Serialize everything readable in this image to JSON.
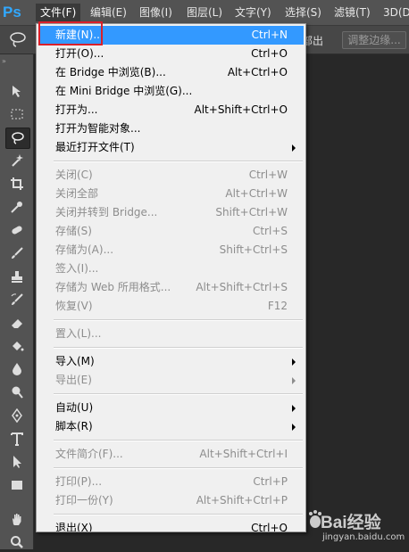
{
  "app": {
    "logo": "Ps"
  },
  "menubar": {
    "items": [
      {
        "label": "文件(F)",
        "active": true
      },
      {
        "label": "编辑(E)"
      },
      {
        "label": "图像(I)"
      },
      {
        "label": "图层(L)"
      },
      {
        "label": "文字(Y)"
      },
      {
        "label": "选择(S)"
      },
      {
        "label": "滤镜(T)"
      },
      {
        "label": "3D(D"
      }
    ]
  },
  "options_bar": {
    "partial_text": "部出",
    "refine_edge_label": "调整边缘..."
  },
  "toolbox": {
    "grip": "»",
    "tools": [
      "move-tool",
      "marquee-tool",
      "lasso-tool",
      "magic-wand-tool",
      "crop-tool",
      "eyedropper-tool",
      "healing-brush-tool",
      "brush-tool",
      "clone-stamp-tool",
      "history-brush-tool",
      "eraser-tool",
      "paint-bucket-tool",
      "blur-tool",
      "dodge-tool",
      "pen-tool",
      "type-tool",
      "path-selection-tool",
      "rectangle-tool",
      "hand-tool",
      "zoom-tool"
    ]
  },
  "file_menu": {
    "items": [
      {
        "label": "新建(N)...",
        "shortcut": "Ctrl+N",
        "highlighted": true
      },
      {
        "label": "打开(O)...",
        "shortcut": "Ctrl+O"
      },
      {
        "label": "在 Bridge 中浏览(B)...",
        "shortcut": "Alt+Ctrl+O"
      },
      {
        "label": "在 Mini Bridge 中浏览(G)...",
        "shortcut": ""
      },
      {
        "label": "打开为...",
        "shortcut": "Alt+Shift+Ctrl+O"
      },
      {
        "label": "打开为智能对象...",
        "shortcut": ""
      },
      {
        "label": "最近打开文件(T)",
        "shortcut": "",
        "submenu": true
      },
      {
        "separator": true
      },
      {
        "label": "关闭(C)",
        "shortcut": "Ctrl+W",
        "disabled": true
      },
      {
        "label": "关闭全部",
        "shortcut": "Alt+Ctrl+W",
        "disabled": true
      },
      {
        "label": "关闭并转到 Bridge...",
        "shortcut": "Shift+Ctrl+W",
        "disabled": true
      },
      {
        "label": "存储(S)",
        "shortcut": "Ctrl+S",
        "disabled": true
      },
      {
        "label": "存储为(A)...",
        "shortcut": "Shift+Ctrl+S",
        "disabled": true
      },
      {
        "label": "签入(I)...",
        "shortcut": "",
        "disabled": true
      },
      {
        "label": "存储为 Web 所用格式...",
        "shortcut": "Alt+Shift+Ctrl+S",
        "disabled": true
      },
      {
        "label": "恢复(V)",
        "shortcut": "F12",
        "disabled": true
      },
      {
        "separator": true
      },
      {
        "label": "置入(L)...",
        "shortcut": "",
        "disabled": true
      },
      {
        "separator": true
      },
      {
        "label": "导入(M)",
        "shortcut": "",
        "submenu": true
      },
      {
        "label": "导出(E)",
        "shortcut": "",
        "submenu": true,
        "disabled": true
      },
      {
        "separator": true
      },
      {
        "label": "自动(U)",
        "shortcut": "",
        "submenu": true
      },
      {
        "label": "脚本(R)",
        "shortcut": "",
        "submenu": true
      },
      {
        "separator": true
      },
      {
        "label": "文件简介(F)...",
        "shortcut": "Alt+Shift+Ctrl+I",
        "disabled": true
      },
      {
        "separator": true
      },
      {
        "label": "打印(P)...",
        "shortcut": "Ctrl+P",
        "disabled": true
      },
      {
        "label": "打印一份(Y)",
        "shortcut": "Alt+Shift+Ctrl+P",
        "disabled": true
      },
      {
        "separator": true
      },
      {
        "label": "退出(X)",
        "shortcut": "Ctrl+Q"
      }
    ]
  },
  "watermark": {
    "text": "Bai经验",
    "sub": "jingyan.baidu.com"
  },
  "colors": {
    "highlight": "#3399ff",
    "callout": "#d9202a"
  }
}
